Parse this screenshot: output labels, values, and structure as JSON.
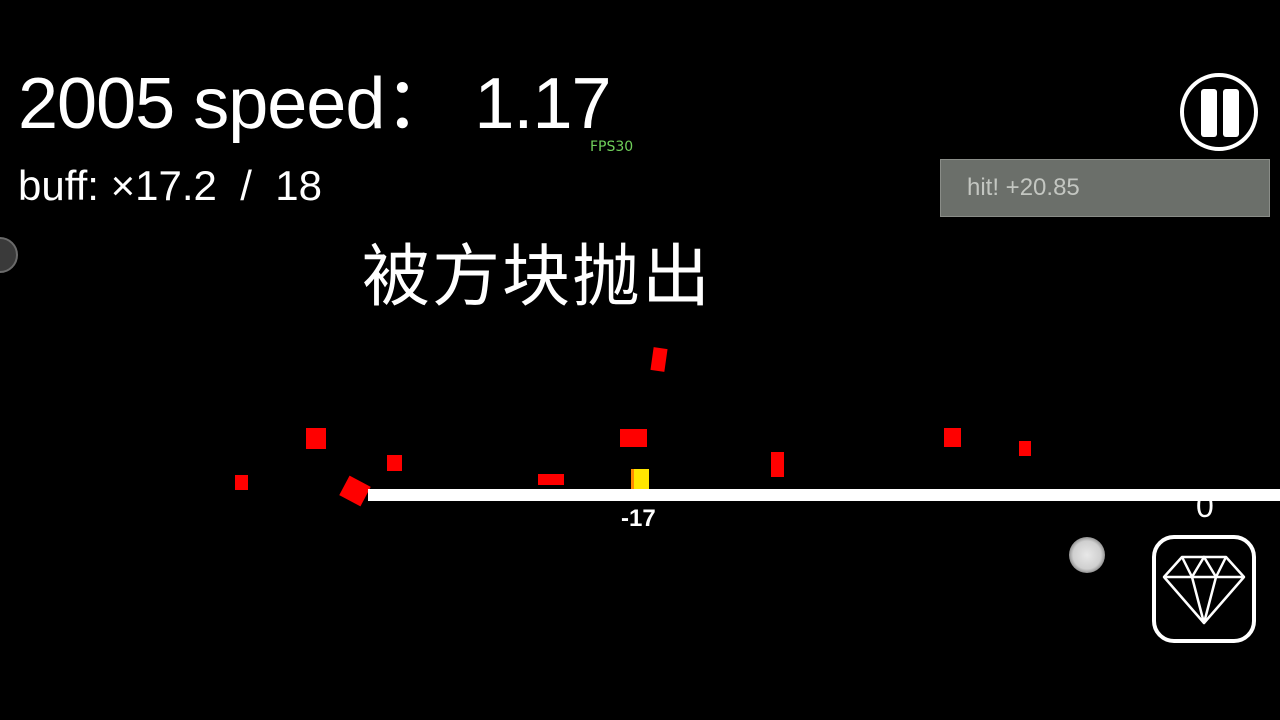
{
  "hud": {
    "score": "2005",
    "speed_label": "speed：",
    "speed_value": "1.17",
    "fps": "FPS30",
    "buff_label": "buff: ×17.2",
    "buff_divider": "/",
    "buff_max": "18"
  },
  "event_text": "被方块抛出",
  "toast": "hit! +20.85",
  "track": {
    "position_label": "-17",
    "corner_value": "0"
  },
  "buttons": {
    "pause_icon": "pause-icon",
    "gem_icon": "diamond-icon"
  },
  "colors": {
    "block": "#ff0000",
    "player": "#ffe600",
    "fps": "#6fcf5a",
    "toast_bg": "#6b6f6a"
  }
}
